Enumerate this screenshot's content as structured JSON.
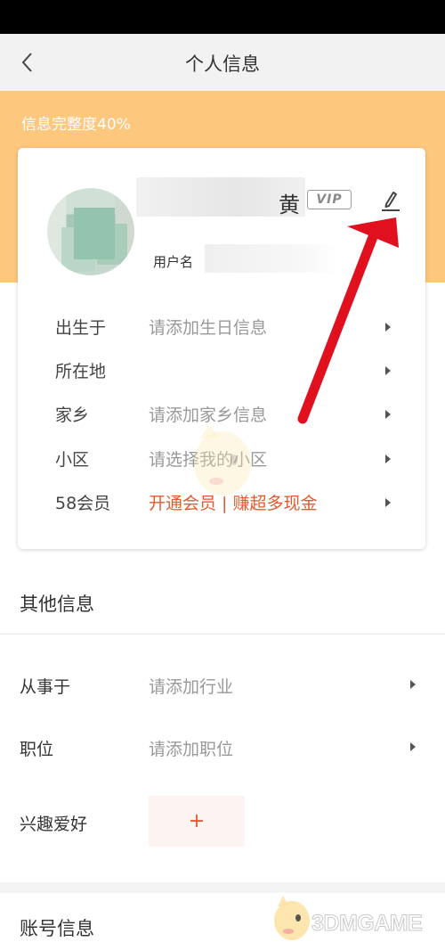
{
  "header": {
    "title": "个人信息"
  },
  "profile": {
    "completeness": "信息完整度40%",
    "name_tail": "黄",
    "vip": "VIP",
    "username_label": "用户名"
  },
  "basic_rows": [
    {
      "label": "出生于",
      "value": "请添加生日信息"
    },
    {
      "label": "所在地",
      "value": ""
    },
    {
      "label": "家乡",
      "value": "请添加家乡信息"
    },
    {
      "label": "小区",
      "value": "请选择我的小区"
    },
    {
      "label": "58会员",
      "value": "开通会员 | 赚超多现金"
    }
  ],
  "other": {
    "title": "其他信息",
    "rows": [
      {
        "label": "从事于",
        "value": "请添加行业"
      },
      {
        "label": "职位",
        "value": "请添加职位"
      }
    ],
    "hobby_label": "兴趣爱好",
    "hobby_add": "+"
  },
  "account": {
    "title": "账号信息"
  },
  "watermark": "3DMGAME",
  "colors": {
    "accent": "#fdc77e",
    "promo": "#e45a2e",
    "annotation_arrow": "#e0101e"
  },
  "icons": {
    "back": "back-chevron-icon",
    "edit": "edit-pencil-icon",
    "row_arrow": "caret-right-icon"
  }
}
